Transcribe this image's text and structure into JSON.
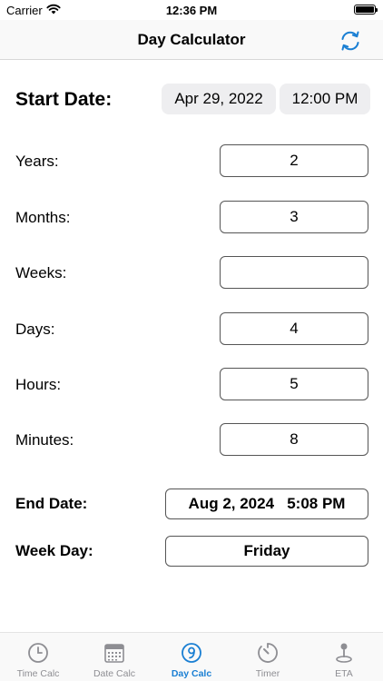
{
  "status_bar": {
    "carrier": "Carrier",
    "time": "12:36 PM"
  },
  "nav": {
    "title": "Day Calculator",
    "refresh_icon": "refresh-icon"
  },
  "start": {
    "label": "Start Date:",
    "date": "Apr 29, 2022",
    "time": "12:00 PM"
  },
  "fields": {
    "years": {
      "label": "Years:",
      "value": "2"
    },
    "months": {
      "label": "Months:",
      "value": "3"
    },
    "weeks": {
      "label": "Weeks:",
      "value": ""
    },
    "days": {
      "label": "Days:",
      "value": "4"
    },
    "hours": {
      "label": "Hours:",
      "value": "5"
    },
    "minutes": {
      "label": "Minutes:",
      "value": "8"
    }
  },
  "results": {
    "end_label": "End Date:",
    "end_value": "Aug 2, 2024   5:08 PM",
    "weekday_label": "Week Day:",
    "weekday_value": "Friday"
  },
  "tabs": [
    {
      "label": "Time Calc",
      "icon": "clock-icon",
      "active": false
    },
    {
      "label": "Date Calc",
      "icon": "calendar-icon",
      "active": false
    },
    {
      "label": "Day Calc",
      "icon": "number-nine-circle-icon",
      "active": true
    },
    {
      "label": "Timer",
      "icon": "timer-icon",
      "active": false
    },
    {
      "label": "ETA",
      "icon": "joystick-pin-icon",
      "active": false
    }
  ],
  "colors": {
    "accent": "#1a7fd3",
    "inactive": "#8e8e93",
    "pill_bg": "#eeeef0"
  }
}
